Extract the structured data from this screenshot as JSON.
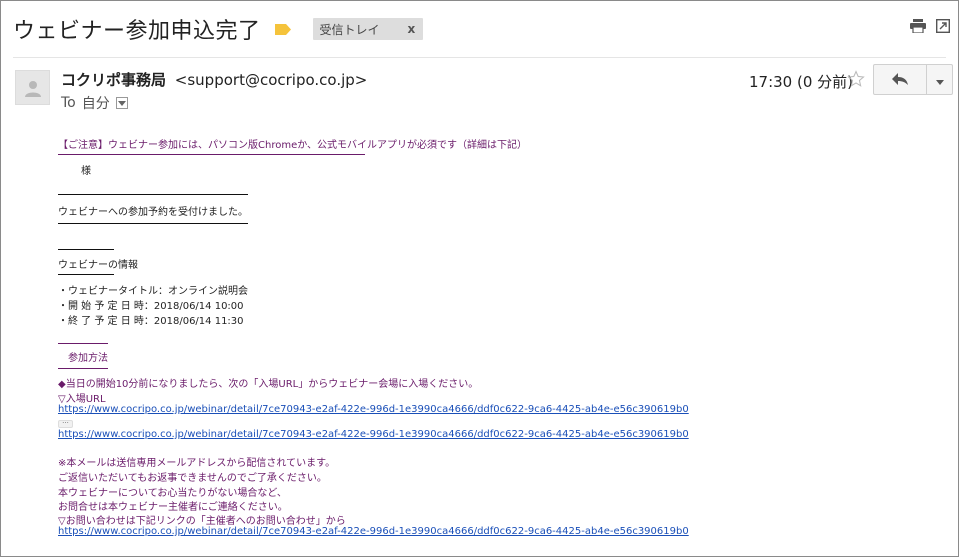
{
  "subject": "ウェビナー参加申込完了",
  "inbox_chip": {
    "label": "受信トレイ",
    "close": "x"
  },
  "sender": {
    "name": "コクリポ事務局",
    "email": "<support@cocripo.co.jp>"
  },
  "recipient": {
    "to_label": "To",
    "me": "自分"
  },
  "timestamp": "17:30 (0 分前)",
  "body": {
    "notice": "【ご注意】ウェビナー参加には、パソコン版Chromeか、公式モバイルアプリが必須です（詳細は下記）",
    "salutation": "様",
    "received": "ウェビナーへの参加予約を受付けました。",
    "info_heading": "ウェビナーの情報",
    "info_title": "・ウェビナータイトル：オンライン説明会",
    "info_start": "・開 始 予 定 日 時：2018/06/14 10:00",
    "info_end": "・終 了 予 定 日 時：2018/06/14 11:30",
    "method_heading": "参加方法",
    "method_text": "◆当日の開始10分前になりましたら、次の「入場URL」からウェビナー会場に入場ください。",
    "entry_url_label": "▽入場URL",
    "entry_url": "https://www.cocripo.co.jp/webinar/detail/7ce70943-e2af-422e-996d-1e3990ca4666/ddf0c622-9ca6-4425-ab4e-e56c390619b0",
    "ellipsis": "···",
    "entry_url_2": "https://www.cocripo.co.jp/webinar/detail/7ce70943-e2af-422e-996d-1e3990ca4666/ddf0c622-9ca6-4425-ab4e-e56c390619b0",
    "footer_1": "※本メールは送信専用メールアドレスから配信されています。",
    "footer_2": "ご返信いただいてもお返事できませんのでご了承ください。",
    "footer_3": "本ウェビナーについてお心当たりがない場合など、",
    "footer_4": "お問合せは本ウェビナー主催者にご連絡ください。",
    "footer_5": "▽お問い合わせは下記リンクの「主催者へのお問い合わせ」から",
    "footer_url": "https://www.cocripo.co.jp/webinar/detail/7ce70943-e2af-422e-996d-1e3990ca4666/ddf0c622-9ca6-4425-ab4e-e56c390619b0"
  },
  "colors": {
    "body_text": "#6a1b6a",
    "link": "#1a4fb8",
    "label_tag": "#f5c33b"
  },
  "icons": [
    "label-tag-icon",
    "print-icon",
    "open-in-new-window-icon",
    "avatar-person-icon",
    "dropdown-icon",
    "star-icon",
    "reply-icon",
    "more-caret-icon"
  ]
}
